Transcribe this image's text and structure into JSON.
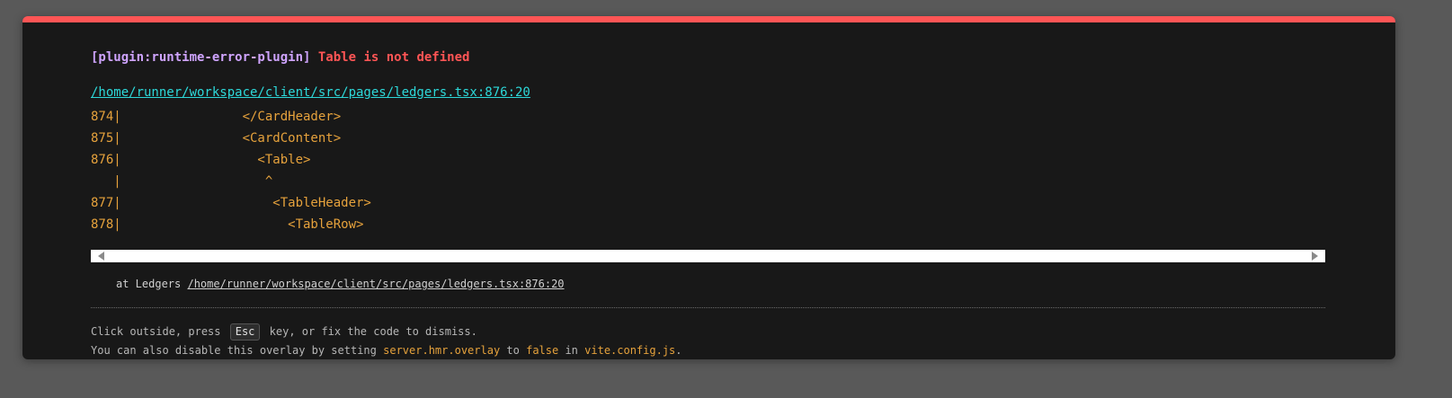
{
  "error": {
    "plugin": "[plugin:runtime-error-plugin]",
    "message": "Table is not defined",
    "file": "/home/runner/workspace/client/src/pages/ledgers.tsx:876:20"
  },
  "frame_lines": [
    "874|                </CardHeader>",
    "875|                <CardContent>",
    "876|                  <Table>",
    "   |                   ^",
    "877|                    <TableHeader>",
    "878|                      <TableRow>"
  ],
  "stack": {
    "prefix": "at Ledgers",
    "link": "/home/runner/workspace/client/src/pages/ledgers.tsx:876:20"
  },
  "tips": {
    "line1_a": "Click outside, press",
    "key": "Esc",
    "line1_b": "key, or fix the code to dismiss.",
    "line2_a": "You can also disable this overlay by setting",
    "setting": "server.hmr.overlay",
    "line2_b": "to",
    "value": "false",
    "line2_c": "in",
    "config": "vite.config.js",
    "line2_d": "."
  },
  "colors": {
    "accent_border": "#ff5555",
    "plugin_text": "#cfa4ff",
    "error_text": "#ff5555",
    "link_text": "#2dd9da",
    "code_text": "#e6a23c",
    "overlay_bg": "#181818",
    "backdrop": "#595959"
  }
}
